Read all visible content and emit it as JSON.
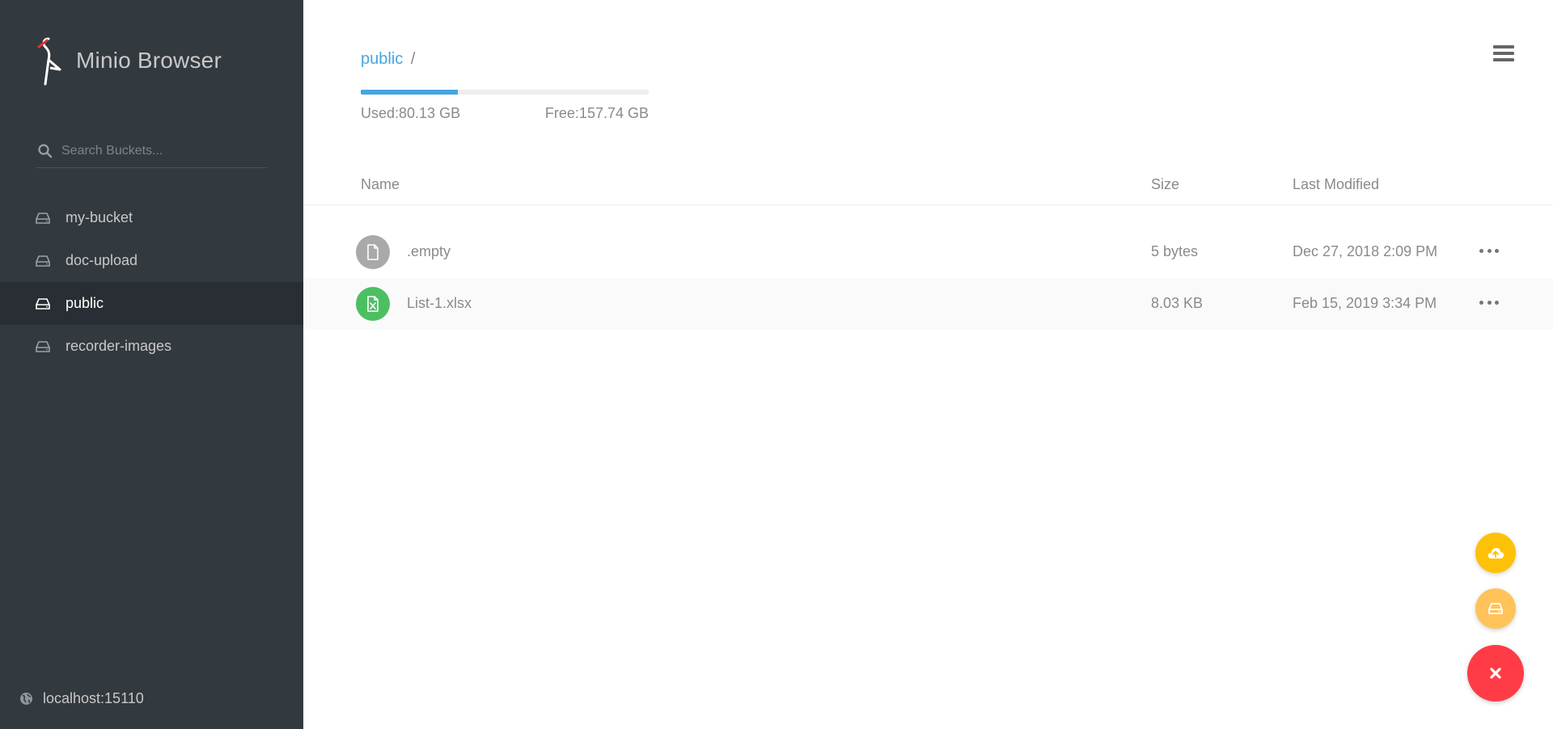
{
  "app": {
    "title": "Minio Browser"
  },
  "search": {
    "placeholder": "Search Buckets..."
  },
  "sidebar": {
    "buckets": [
      {
        "label": "my-bucket",
        "active": false
      },
      {
        "label": "doc-upload",
        "active": false
      },
      {
        "label": "public",
        "active": true
      },
      {
        "label": "recorder-images",
        "active": false
      }
    ],
    "host": "localhost:15110"
  },
  "main": {
    "breadcrumb": {
      "bucket": "public",
      "separator": "/"
    },
    "storage": {
      "used": "Used:80.13 GB",
      "free": "Free:157.74 GB",
      "used_fraction": 0.337
    },
    "columns": {
      "name": "Name",
      "size": "Size",
      "modified": "Last Modified"
    },
    "files": [
      {
        "name": ".empty",
        "size": "5 bytes",
        "modified": "Dec 27, 2018 2:09 PM",
        "icon": "file-icon",
        "color": "#a9a9a9"
      },
      {
        "name": "List-1.xlsx",
        "size": "8.03 KB",
        "modified": "Feb 15, 2019 3:34 PM",
        "icon": "excel-file-icon",
        "color": "#4cbf62"
      }
    ]
  },
  "colors": {
    "sidebar": "#32393f",
    "accent": "#46a5e0",
    "fab_upload": "#ffc107",
    "fab_bucket": "#ffc35a",
    "fab_close": "#ff3c46"
  }
}
